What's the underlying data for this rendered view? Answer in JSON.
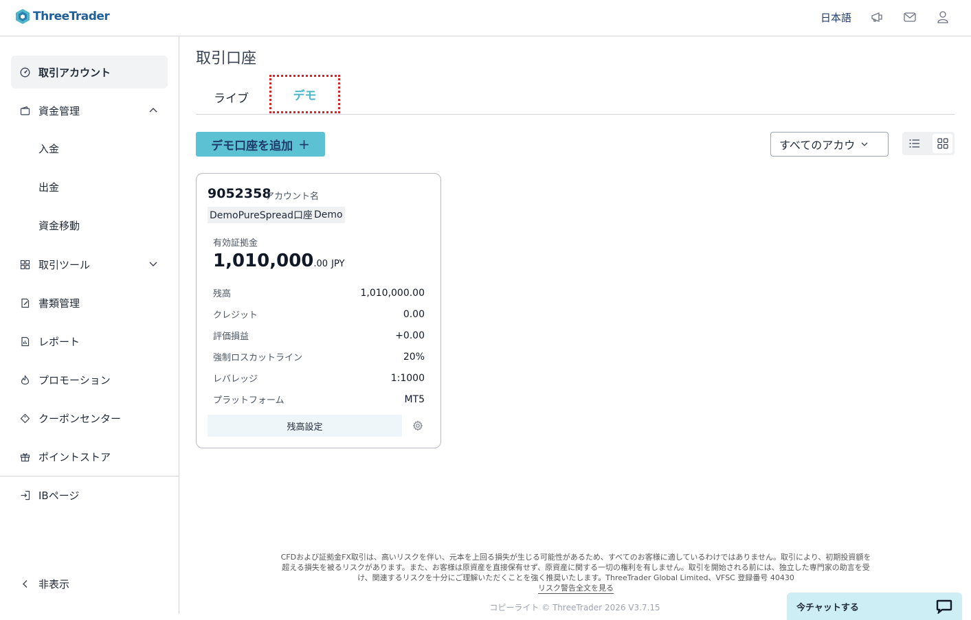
{
  "header": {
    "brand": "ThreeTrader",
    "language": "日本語"
  },
  "sidebar": {
    "items": [
      {
        "label": "取引アカウント",
        "icon": "dashboard-icon"
      },
      {
        "label": "資金管理",
        "icon": "wallet-icon"
      },
      {
        "label": "取引ツール",
        "icon": "tools-icon"
      },
      {
        "label": "書類管理",
        "icon": "document-icon"
      },
      {
        "label": "レポート",
        "icon": "report-icon"
      },
      {
        "label": "プロモーション",
        "icon": "flame-icon"
      },
      {
        "label": "クーポンセンター",
        "icon": "coupon-icon"
      },
      {
        "label": "ポイントストア",
        "icon": "gift-icon"
      }
    ],
    "subitems": [
      "入金",
      "出金",
      "資金移動"
    ],
    "ib_page": "IBページ",
    "hide": "非表示"
  },
  "main": {
    "title": "取引口座",
    "tabs": [
      "ライブ",
      "デモ"
    ],
    "active_tab": "デモ",
    "add_button": "デモ口座を追加",
    "filter": "すべてのアカウ"
  },
  "account_card": {
    "id": "9052358",
    "name_label": "アカウント名",
    "tags": [
      "DemoPureSpread口座",
      "Demo"
    ],
    "equity_label": "有効証拠金",
    "equity_main": "1,010,000",
    "equity_decimal": ".00",
    "currency": "JPY",
    "rows": [
      {
        "label": "残高",
        "value": "1,010,000.00"
      },
      {
        "label": "クレジット",
        "value": "0.00"
      },
      {
        "label": "評価損益",
        "value": "+0.00"
      },
      {
        "label": "強制ロスカットライン",
        "value": "20%"
      },
      {
        "label": "レバレッジ",
        "value": "1:1000"
      },
      {
        "label": "プラットフォーム",
        "value": "MT5"
      }
    ],
    "balance_button": "残高設定"
  },
  "footer": {
    "disclaimer": "CFDおよび証拠金FX取引は、高いリスクを伴い、元本を上回る損失が生じる可能性があるため、すべてのお客様に適しているわけではありません。取引により、初期投資額を超える損失を被るリスクがあります。また、お客様は原資産を直接保有せず、原資産に関する一切の権利を有しません。取引を開始される前には、独立した専門家の助言を受け、関連するリスクを十分にご理解いただくことを強く推奨いたします。ThreeTrader Global Limited、VFSC 登録番号 40430",
    "risk_link": "リスク警告全文を見る",
    "copyright": "コピーライト © ThreeTrader 2026 V3.7.15"
  },
  "chat": {
    "label": "今チャットする"
  },
  "colors": {
    "accent": "#5cc1d2",
    "brand": "#1f5f9a",
    "highlight": "#e02020"
  }
}
